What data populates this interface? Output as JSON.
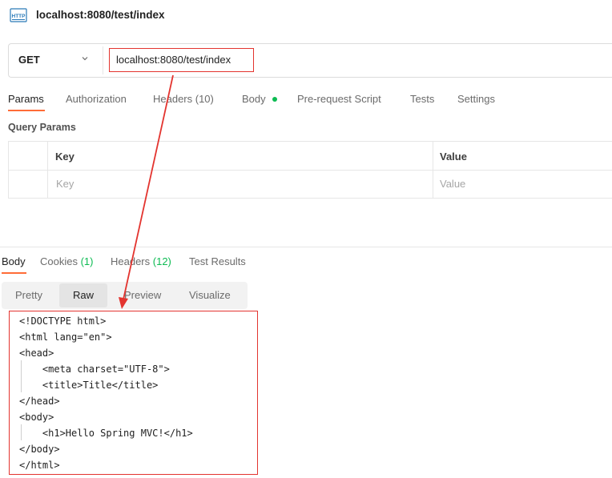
{
  "header": {
    "icon_text": "HTTP",
    "title": "localhost:8080/test/index"
  },
  "request": {
    "method": "GET",
    "url": "localhost:8080/test/index"
  },
  "request_tabs": [
    {
      "label": "Params",
      "active": true
    },
    {
      "label": "Authorization"
    },
    {
      "label": "Headers (10)"
    },
    {
      "label": "Body"
    },
    {
      "label": "Pre-request Script"
    },
    {
      "label": "Tests"
    },
    {
      "label": "Settings"
    }
  ],
  "query_params": {
    "label": "Query Params",
    "columns": [
      "Key",
      "Value"
    ],
    "placeholder_key": "Key",
    "placeholder_value": "Value"
  },
  "response_tabs": {
    "body": "Body",
    "cookies": "Cookies",
    "cookies_count": "(1)",
    "headers": "Headers",
    "headers_count": "(12)",
    "test_results": "Test Results"
  },
  "formats": [
    {
      "label": "Pretty"
    },
    {
      "label": "Raw",
      "active": true
    },
    {
      "label": "Preview"
    },
    {
      "label": "Visualize"
    }
  ],
  "code_lines": [
    "<!DOCTYPE html>",
    "<html lang=\"en\">",
    "<head>",
    "    <meta charset=\"UTF-8\">",
    "    <title>Title</title>",
    "</head>",
    "<body>",
    "    <h1>Hello Spring MVC!</h1>",
    "</body>",
    "</html>"
  ],
  "colors": {
    "accent": "#ff6c37",
    "success": "#0cbb52",
    "annotation": "#e3342f"
  }
}
